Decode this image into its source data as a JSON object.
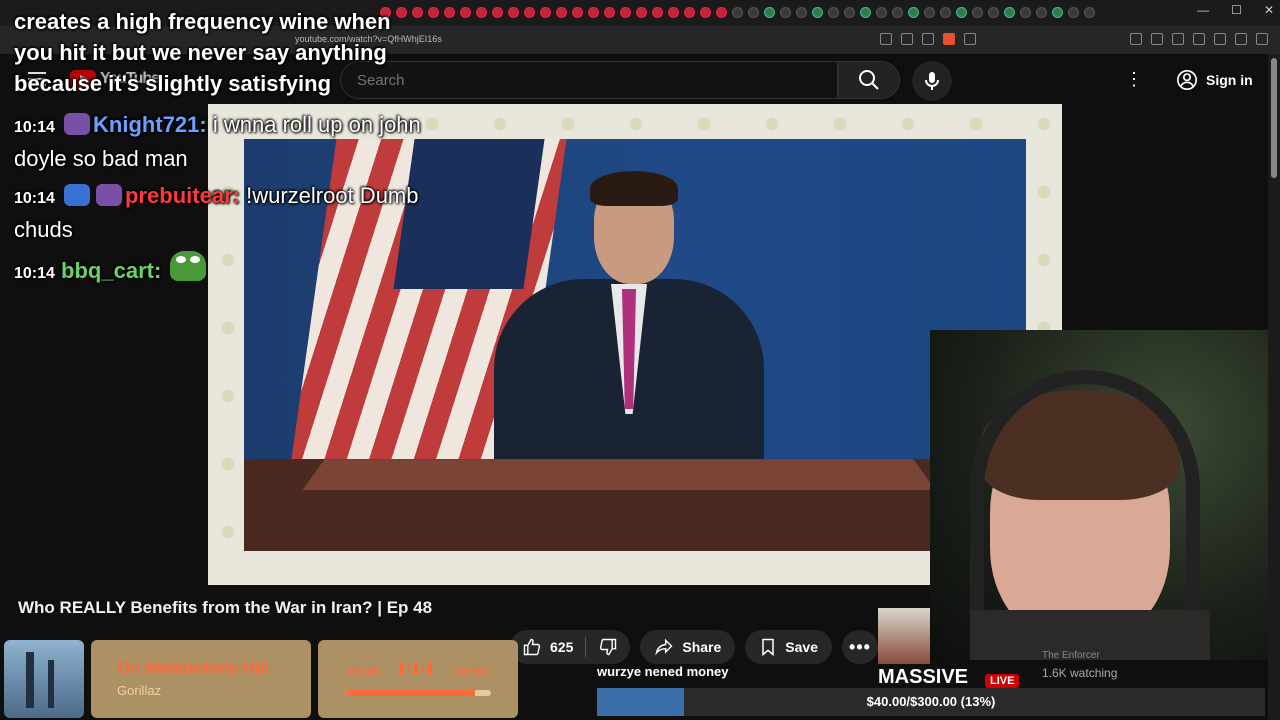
{
  "browser": {
    "url": "youtube.com/watch?v=QfHWhjEI16s"
  },
  "header": {
    "logo": "YouTube",
    "search_placeholder": "Search",
    "sign_in": "Sign in"
  },
  "video": {
    "title": "Who REALLY Benefits from the War in Iran? | Ep 48",
    "likes": "625",
    "share_label": "Share",
    "save_label": "Save"
  },
  "chat": {
    "partial_lines": [
      "creates a high frequency wine when",
      "you hit it but we never say anything",
      "because it's slightly satisfying"
    ],
    "messages": [
      {
        "time": "10:14",
        "user": "Knight721",
        "text": "i wnna roll up on john doyle so bad man",
        "color": "#6ca0ff"
      },
      {
        "time": "10:14",
        "user": "prebuitear",
        "text": "!wurzelroot Dumb chuds",
        "color": "#ff3a3a"
      },
      {
        "time": "10:14",
        "user": "bbq_cart",
        "text": "",
        "color": "#6bd26b"
      }
    ]
  },
  "now_playing": {
    "title": "On Melancholy Hill",
    "artist": "Gorillaz",
    "elapsed": "03:28",
    "total": "03:53",
    "progress": 0.89
  },
  "donation": {
    "message": "wurzye nened money",
    "goal_text": "$40.00/$300.00 (13%)",
    "fraction": 0.13
  },
  "recommended": {
    "headline": "MASSIVE",
    "live": "LIVE",
    "watching": "1.6K watching",
    "channel": "The Enforcer"
  },
  "colors": {
    "accent": "#ff6a3a",
    "yt_red": "#ff0000"
  }
}
